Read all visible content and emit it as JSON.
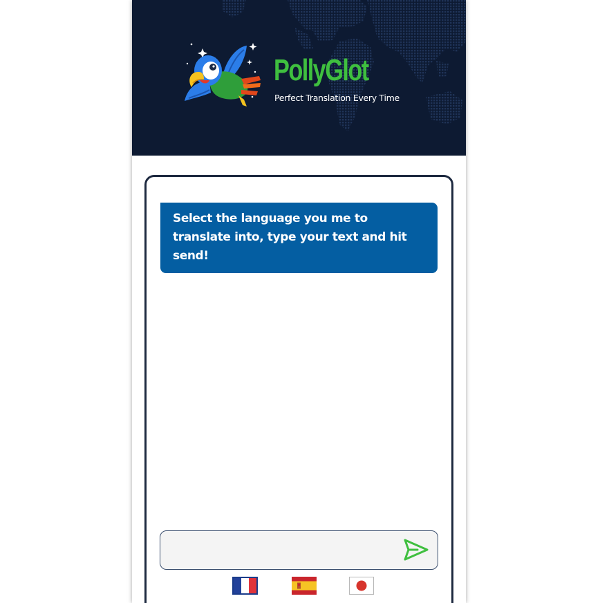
{
  "header": {
    "title": "PollyGlot",
    "tagline": "Perfect Translation Every Time",
    "background_color": "#0d1a32",
    "title_color": "#3fbf3f"
  },
  "chat": {
    "messages": [
      {
        "role": "assistant",
        "text": "Select the language you me to translate into, type your text and hit send!"
      }
    ],
    "bubble_color": "#045ea2"
  },
  "composer": {
    "input_value": "",
    "input_placeholder": "",
    "send_icon": "send-arrow-icon",
    "send_icon_color": "#3fbf3f"
  },
  "languages": [
    {
      "name": "French",
      "icon": "france-flag-icon"
    },
    {
      "name": "Spanish",
      "icon": "spain-flag-icon"
    },
    {
      "name": "Japanese",
      "icon": "japan-flag-icon"
    }
  ]
}
